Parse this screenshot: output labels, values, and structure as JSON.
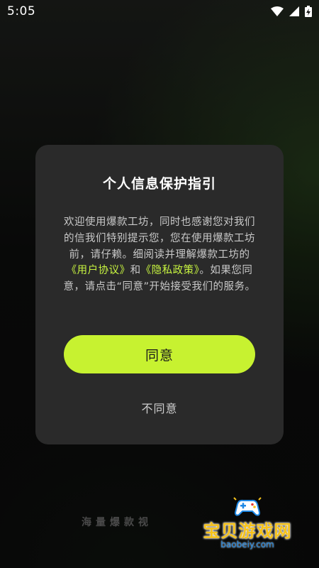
{
  "status_bar": {
    "time": "5:05",
    "icons": [
      "wifi-icon",
      "signal-icon",
      "battery-charging-icon"
    ]
  },
  "dialog": {
    "title": "个人信息保护指引",
    "body_text_before_links": "欢迎使用爆款工坊，同时也感谢您对我们的信我们特别提示您，您在使用爆款工坊前，请仔赖。细阅读并理解爆款工坊的",
    "user_agreement_link": "《用户协议》",
    "conjunction": "和",
    "privacy_policy_link": "《隐私政策》",
    "body_text_after_links": "。如果您同意，请点击“同意”开始接受我们的服务。",
    "agree_label": "同意",
    "disagree_label": "不同意"
  },
  "background": {
    "tagline": "海量爆款视"
  },
  "watermark": {
    "title": "宝贝游戏网",
    "url": "baobeiy.com",
    "icon": "gamepad-icon"
  },
  "colors": {
    "accent": "#c7f230",
    "link": "#c8f540",
    "dialog_bg": "#2a2a2a"
  }
}
